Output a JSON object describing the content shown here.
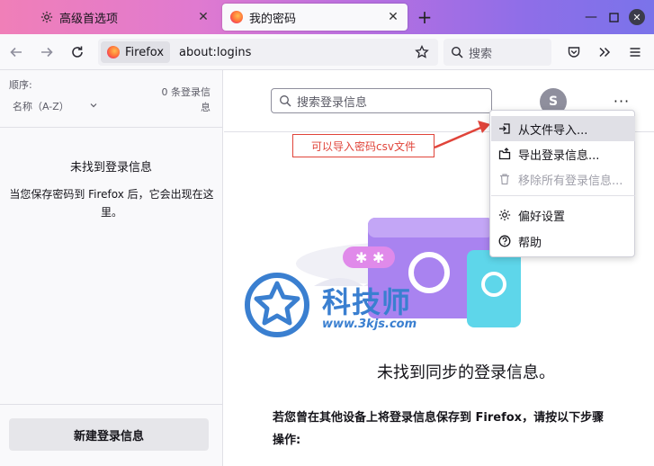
{
  "tabs": [
    {
      "label": "高级首选项",
      "icon": "gear-icon"
    },
    {
      "label": "我的密码",
      "icon": "firefox-icon"
    }
  ],
  "urlbar": {
    "identity": "Firefox",
    "url": "about:logins"
  },
  "searchbar": {
    "placeholder": "搜索"
  },
  "sidebar": {
    "sort_label": "顺序:",
    "sort_value": "名称（A-Z）",
    "count_line1": "0 条登录信",
    "count_line2": "息",
    "empty_title": "未找到登录信息",
    "empty_text": "当您保存密码到 Firefox 后，它会出现在这里。",
    "new_login": "新建登录信息"
  },
  "main": {
    "filter_placeholder": "搜索登录信息",
    "account_initial": "S",
    "more_label": "···",
    "callout": "可以导入密码csv文件",
    "sync_title": "未找到同步的登录信息。",
    "sync_desc": "若您曾在其他设备上将登录信息保存到 Firefox，请按以下步骤操作:"
  },
  "menu": {
    "import_file": "从文件导入...",
    "export": "导出登录信息...",
    "remove_all": "移除所有登录信息...",
    "preferences": "偏好设置",
    "help": "帮助"
  },
  "watermark": {
    "text": "科技师",
    "url": "www.3kjs.com"
  },
  "colors": {
    "accent": "#0060df",
    "callout": "#e0443a",
    "watermark": "#3a7fd0"
  }
}
